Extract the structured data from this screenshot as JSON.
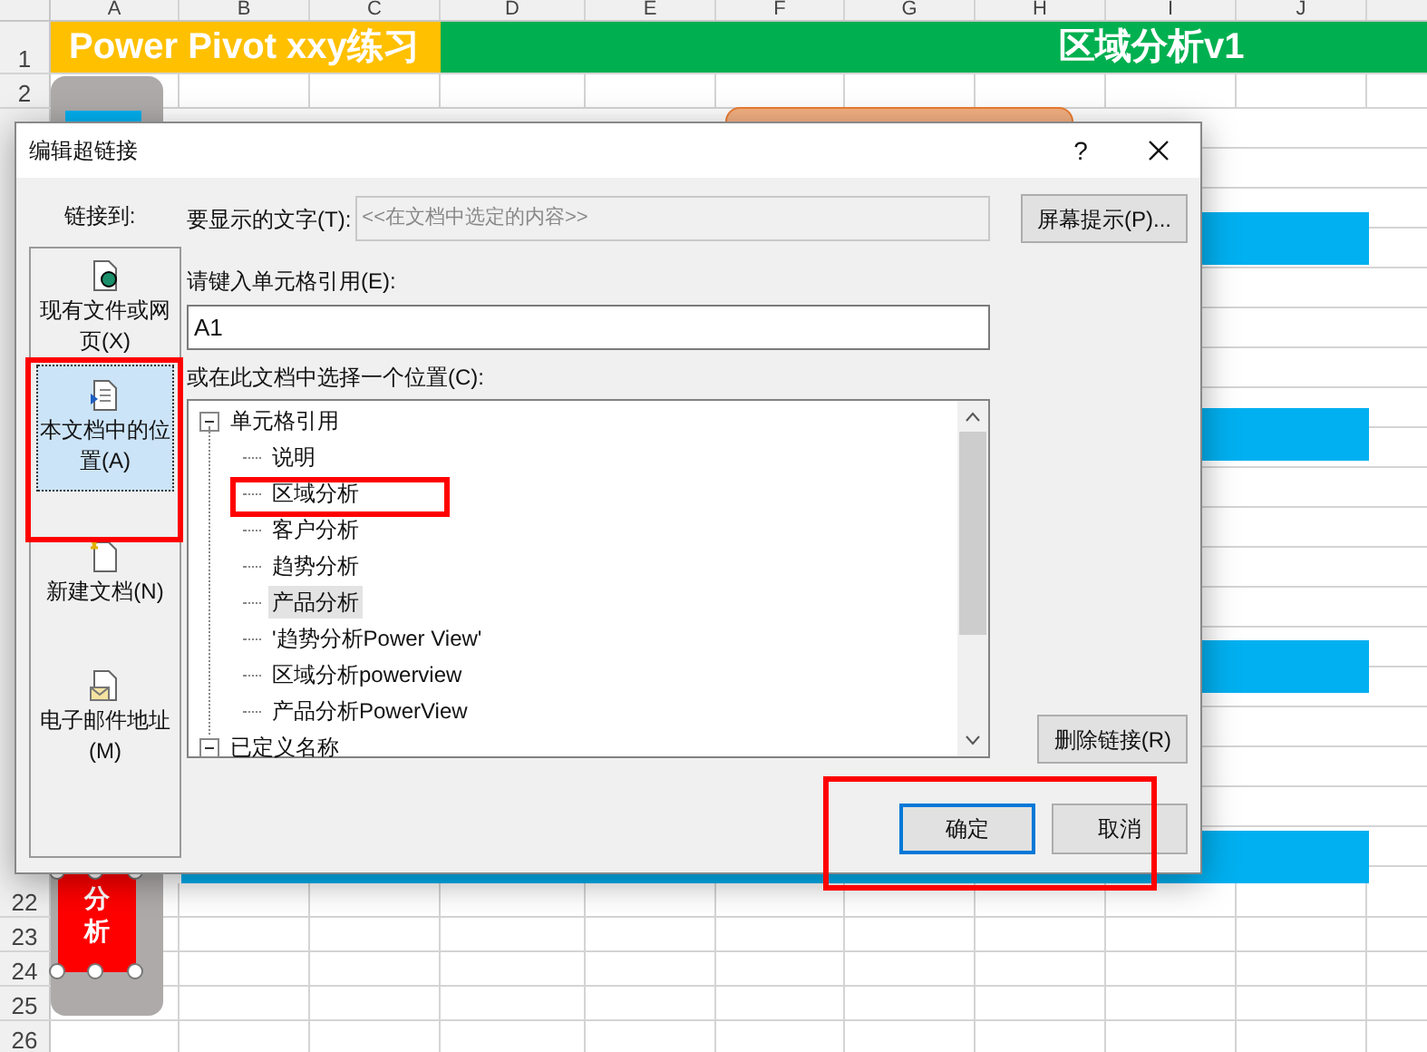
{
  "sheet": {
    "columns": [
      "A",
      "B",
      "C",
      "D",
      "E",
      "F",
      "G",
      "H",
      "I",
      "J"
    ],
    "title_row": {
      "label": "1",
      "left_title": "Power Pivot xxy练习",
      "right_title": "区域分析v1"
    },
    "rows_top": [
      {
        "label": "2"
      }
    ],
    "rows_bottom": [
      {
        "label": "22"
      },
      {
        "label": "23"
      },
      {
        "label": "24"
      },
      {
        "label": "25"
      },
      {
        "label": "26"
      }
    ],
    "shape_text": "分析"
  },
  "dialog": {
    "title": "编辑超链接",
    "help": "?",
    "link_to_label": "链接到:",
    "link_types": [
      {
        "label": "现有文件或网页(X)",
        "kind": "file",
        "selected": false
      },
      {
        "label": "本文档中的位置(A)",
        "kind": "place",
        "selected": true
      },
      {
        "label": "新建文档(N)",
        "kind": "new",
        "selected": false
      },
      {
        "label": "电子邮件地址(M)",
        "kind": "email",
        "selected": false
      }
    ],
    "display_text": {
      "label": "要显示的文字(T):",
      "value": "<<在文档中选定的内容>>",
      "disabled": true
    },
    "screen_tip_button": "屏幕提示(P)...",
    "cell_ref": {
      "label": "请键入单元格引用(E):",
      "value": "A1"
    },
    "place_label": "或在此文档中选择一个位置(C):",
    "tree": [
      {
        "label": "单元格引用",
        "expanded": true,
        "children": [
          {
            "label": "说明",
            "selected": false
          },
          {
            "label": "区域分析",
            "selected": false
          },
          {
            "label": "客户分析",
            "selected": false
          },
          {
            "label": "趋势分析",
            "selected": false
          },
          {
            "label": "产品分析",
            "selected": true
          },
          {
            "label": "'趋势分析Power View'",
            "selected": false
          },
          {
            "label": "区域分析powerview",
            "selected": false
          },
          {
            "label": "产品分析PowerView",
            "selected": false
          }
        ]
      },
      {
        "label": "已定义名称",
        "expanded": true
      }
    ],
    "remove_link_button": "删除链接(R)",
    "ok_button": "确定",
    "cancel_button": "取消"
  }
}
